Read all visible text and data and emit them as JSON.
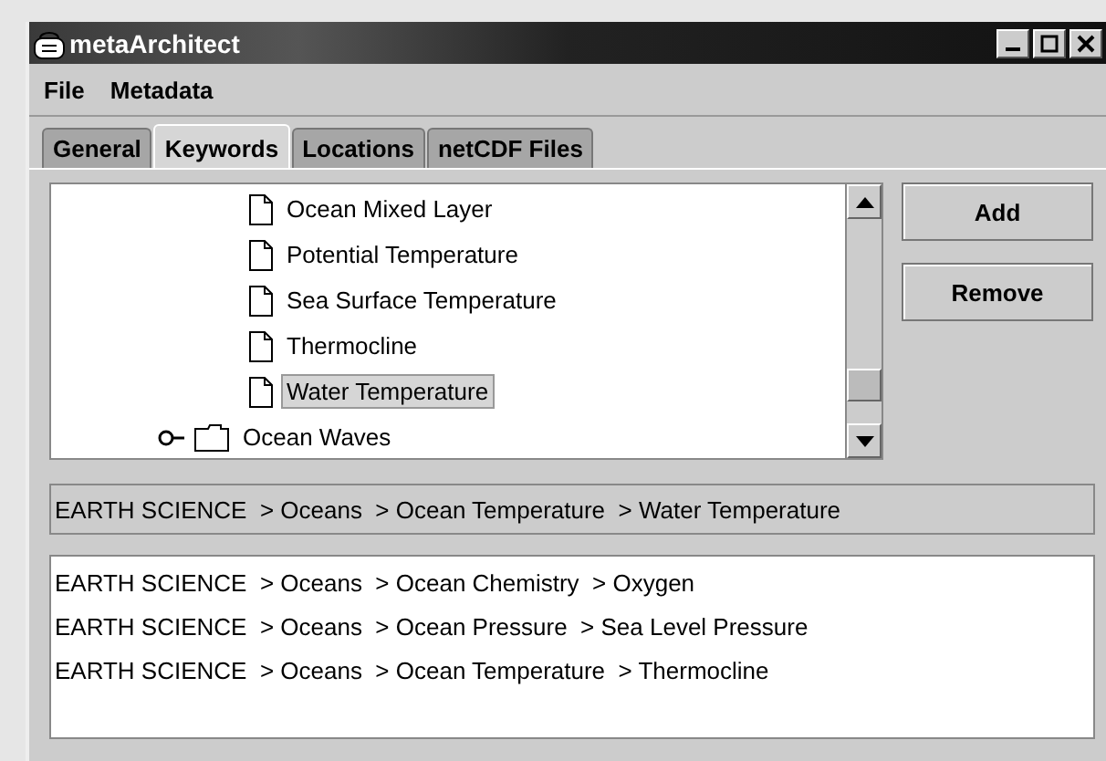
{
  "window": {
    "title": "metaArchitect"
  },
  "menu": [
    "File",
    "Metadata"
  ],
  "tabs": [
    {
      "label": "General",
      "selected": false
    },
    {
      "label": "Keywords",
      "selected": true
    },
    {
      "label": "Locations",
      "selected": false
    },
    {
      "label": "netCDF Files",
      "selected": false
    }
  ],
  "tree": {
    "items": [
      {
        "children": [
          {
            "kind": "leaf",
            "label": "Ocean Mixed Layer",
            "selected": false
          },
          {
            "kind": "leaf",
            "label": "Potential Temperature",
            "selected": false
          },
          {
            "kind": "leaf",
            "label": "Sea Surface Temperature",
            "selected": false
          },
          {
            "kind": "leaf",
            "label": "Thermocline",
            "selected": false
          },
          {
            "kind": "leaf",
            "label": "Water Temperature",
            "selected": true
          }
        ]
      },
      {
        "kind": "folder",
        "label": "Ocean Waves",
        "expanded": false,
        "selected": false
      }
    ]
  },
  "buttons": [
    "Add",
    "Remove"
  ],
  "current_path": "EARTH SCIENCE  > Oceans  > Ocean Temperature  > Water Temperature",
  "keywords": [
    "EARTH SCIENCE  > Oceans  > Ocean Chemistry  > Oxygen",
    "EARTH SCIENCE  > Oceans  > Ocean Pressure  > Sea Level Pressure",
    "EARTH SCIENCE  > Oceans  > Ocean Temperature  > Thermocline"
  ]
}
